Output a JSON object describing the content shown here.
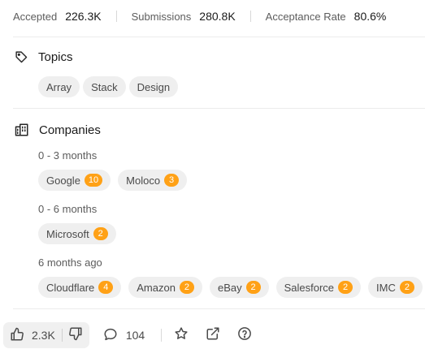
{
  "stats": [
    {
      "label": "Accepted",
      "value": "226.3K"
    },
    {
      "label": "Submissions",
      "value": "280.8K"
    },
    {
      "label": "Acceptance Rate",
      "value": "80.6%"
    }
  ],
  "topics": {
    "title": "Topics",
    "tags": [
      "Array",
      "Stack",
      "Design"
    ]
  },
  "companies": {
    "title": "Companies",
    "periods": [
      {
        "label": "0 - 3 months",
        "companies": [
          {
            "name": "Google",
            "count": "10"
          },
          {
            "name": "Moloco",
            "count": "3"
          }
        ]
      },
      {
        "label": "0 - 6 months",
        "companies": [
          {
            "name": "Microsoft",
            "count": "2"
          }
        ]
      },
      {
        "label": "6 months ago",
        "companies": [
          {
            "name": "Cloudflare",
            "count": "4"
          },
          {
            "name": "Amazon",
            "count": "2"
          },
          {
            "name": "eBay",
            "count": "2"
          },
          {
            "name": "Salesforce",
            "count": "2"
          },
          {
            "name": "IMC",
            "count": "2"
          }
        ]
      }
    ]
  },
  "footer": {
    "likes": "2.3K",
    "comments": "104",
    "icons": [
      "thumbs-up-icon",
      "thumbs-down-icon",
      "comment-icon",
      "star-icon",
      "share-icon",
      "help-icon"
    ]
  },
  "colors": {
    "badge": "#ffa116",
    "chip_bg": "#efefef",
    "divider": "#ececec"
  }
}
